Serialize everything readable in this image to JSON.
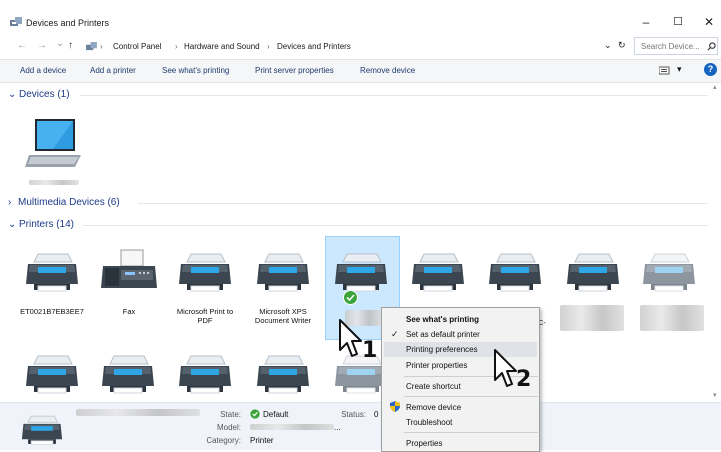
{
  "window": {
    "title": "Devices and Printers",
    "minimize": "–",
    "maximize": "☐",
    "close": "✕"
  },
  "nav": {
    "back": "←",
    "forward": "→",
    "recent": "⌄",
    "up": "↑",
    "refresh": "↻",
    "dropdown": "⌄"
  },
  "breadcrumb": {
    "sep": "›",
    "items": [
      "Control Panel",
      "Hardware and Sound",
      "Devices and Printers"
    ]
  },
  "search": {
    "placeholder": "Search Device..."
  },
  "commands": [
    "Add a device",
    "Add a printer",
    "See what's printing",
    "Print server properties",
    "Remove device"
  ],
  "view_toggle": "▾",
  "help": "?",
  "groups": {
    "devices": {
      "label": "Devices (1)",
      "chevron": "⌄"
    },
    "multimedia": {
      "label": "Multimedia Devices (6)",
      "chevron": "›"
    },
    "printers": {
      "label": "Printers (14)",
      "chevron": "⌄"
    }
  },
  "printers": [
    {
      "name": "ET0021B7EB3EE7",
      "icon": "printer-icon"
    },
    {
      "name": "Fax",
      "icon": "fax-icon"
    },
    {
      "name": "Microsoft Print to PDF",
      "icon": "printer-icon"
    },
    {
      "name": "Microsoft XPS Document Writer",
      "icon": "printer-icon"
    },
    {
      "name": "",
      "icon": "printer-icon",
      "selected": true,
      "default": true
    },
    {
      "name": "",
      "icon": "printer-icon"
    },
    {
      "name": "C-",
      "icon": "printer-icon"
    },
    {
      "name": "",
      "icon": "printer-icon"
    },
    {
      "name": "",
      "icon": "printer-icon"
    }
  ],
  "details": {
    "state_label": "State:",
    "state_value": "Default",
    "status_label": "Status:",
    "status_value": "0",
    "model_label": "Model:",
    "model_suffix": "...",
    "category_label": "Category:",
    "category_value": "Printer"
  },
  "context_menu": {
    "items": [
      {
        "label": "See what's printing",
        "bold": true
      },
      {
        "label": "Set as default printer",
        "check": "✓"
      },
      {
        "label": "Printing preferences",
        "highlight": true
      },
      {
        "label": "Printer properties"
      },
      {
        "label": "Create shortcut"
      },
      {
        "label": "Remove device",
        "shield": true
      },
      {
        "label": "Troubleshoot"
      },
      {
        "label": "Properties"
      }
    ]
  },
  "callouts": [
    "1",
    "2"
  ],
  "colors": {
    "accent": "#1e3a8a",
    "selection": "#cce8ff",
    "default_badge": "#3aa43a",
    "menu_highlight": "#dfe3e8"
  }
}
